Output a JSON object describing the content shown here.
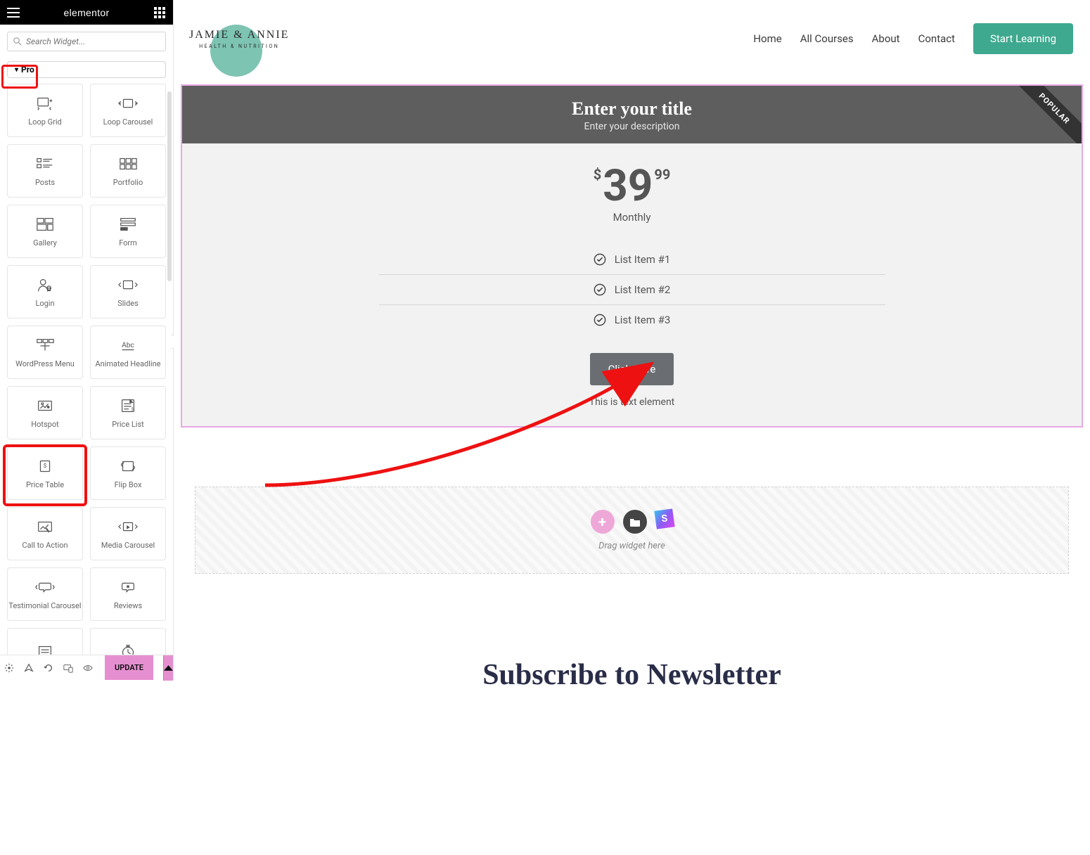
{
  "sidebar": {
    "logo": "elementor",
    "search_placeholder": "Search Widget...",
    "pro_label": "Pro",
    "widgets": [
      {
        "label": "Loop Grid"
      },
      {
        "label": "Loop Carousel"
      },
      {
        "label": "Posts"
      },
      {
        "label": "Portfolio"
      },
      {
        "label": "Gallery"
      },
      {
        "label": "Form"
      },
      {
        "label": "Login"
      },
      {
        "label": "Slides"
      },
      {
        "label": "WordPress Menu"
      },
      {
        "label": "Animated Headline"
      },
      {
        "label": "Hotspot"
      },
      {
        "label": "Price List"
      },
      {
        "label": "Price Table"
      },
      {
        "label": "Flip Box"
      },
      {
        "label": "Call to Action"
      },
      {
        "label": "Media Carousel"
      },
      {
        "label": "Testimonial Carousel"
      },
      {
        "label": "Reviews"
      }
    ],
    "update_label": "UPDATE"
  },
  "site": {
    "logo_main": "JAMIE & ANNIE",
    "logo_sub": "HEALTH & NUTRITION",
    "nav": [
      "Home",
      "All Courses",
      "About",
      "Contact"
    ],
    "cta": "Start Learning"
  },
  "price_table": {
    "title": "Enter your title",
    "subtitle": "Enter your description",
    "ribbon": "POPULAR",
    "currency": "$",
    "amount": "39",
    "cents": "99",
    "period": "Monthly",
    "features": [
      "List Item #1",
      "List Item #2",
      "List Item #3"
    ],
    "button": "Click Here",
    "footer": "This is text element"
  },
  "dropzone": {
    "hint": "Drag widget here"
  },
  "newsletter": {
    "heading": "Subscribe to Newsletter"
  }
}
